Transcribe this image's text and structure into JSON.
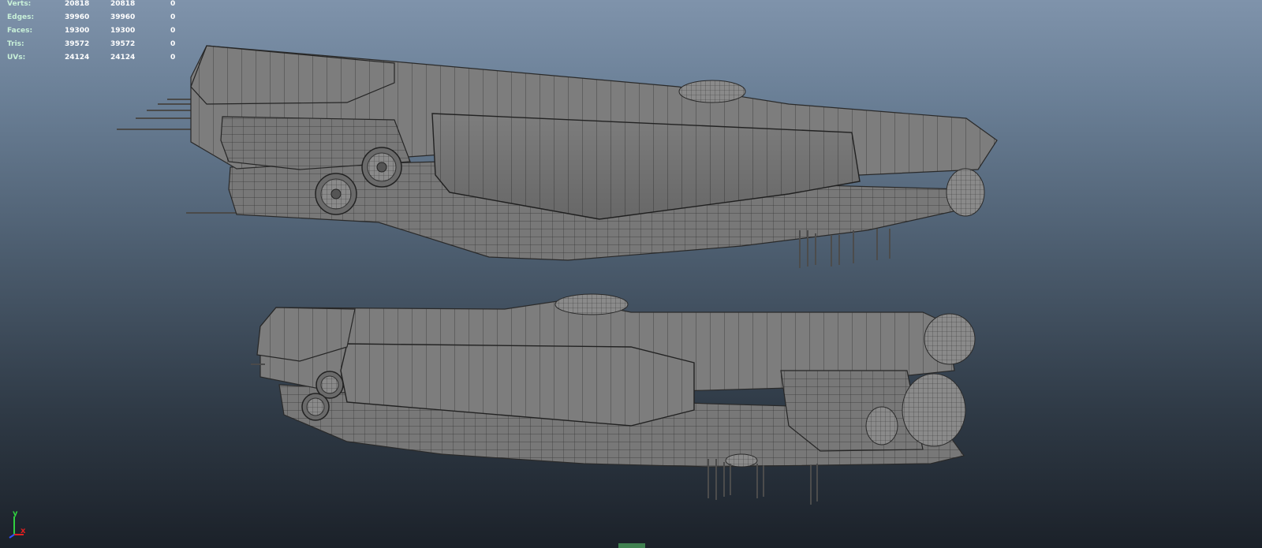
{
  "stats": {
    "rows": [
      {
        "label": "Verts:",
        "values": [
          "20818",
          "20818",
          "0"
        ]
      },
      {
        "label": "Edges:",
        "values": [
          "39960",
          "39960",
          "0"
        ]
      },
      {
        "label": "Faces:",
        "values": [
          "19300",
          "19300",
          "0"
        ]
      },
      {
        "label": "Tris:",
        "values": [
          "39572",
          "39572",
          "0"
        ]
      },
      {
        "label": "UVs:",
        "values": [
          "24124",
          "24124",
          "0"
        ]
      }
    ]
  },
  "axes": {
    "y": "y",
    "x": "x"
  },
  "colors": {
    "label": "#c8f0d8",
    "value": "#ffffff",
    "axis_x": "#e02020",
    "axis_y": "#30d040",
    "axis_z": "#3050ff",
    "hull": "#7c7c7c",
    "wire": "#2e2e2e"
  }
}
